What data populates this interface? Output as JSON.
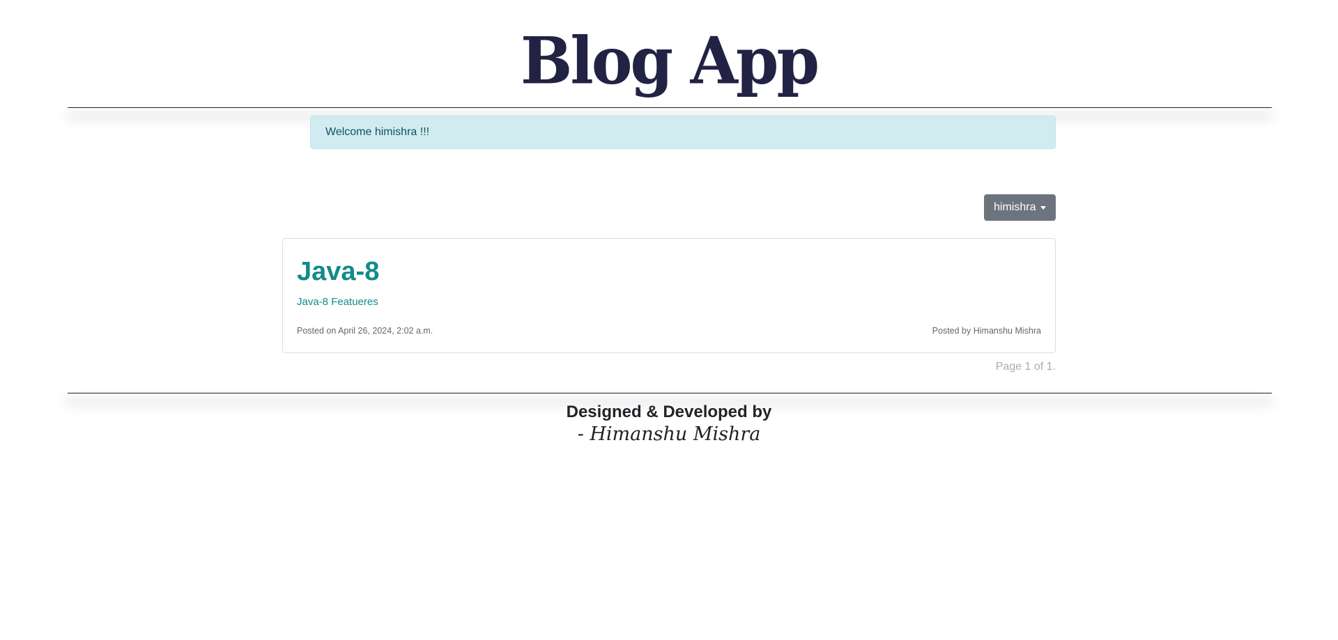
{
  "header": {
    "title": "Blog App"
  },
  "alert": {
    "message": "Welcome himishra !!!"
  },
  "user_menu": {
    "username": "himishra"
  },
  "posts": [
    {
      "title": "Java-8",
      "subtitle": "Java-8 Featueres",
      "posted_on": "Posted on April 26, 2024, 2:02 a.m.",
      "posted_by": "Posted by Himanshu Mishra"
    }
  ],
  "pagination": {
    "text": "Page 1 of 1."
  },
  "footer": {
    "line1": "Designed & Developed by",
    "line2": "- Himanshu Mishra"
  }
}
